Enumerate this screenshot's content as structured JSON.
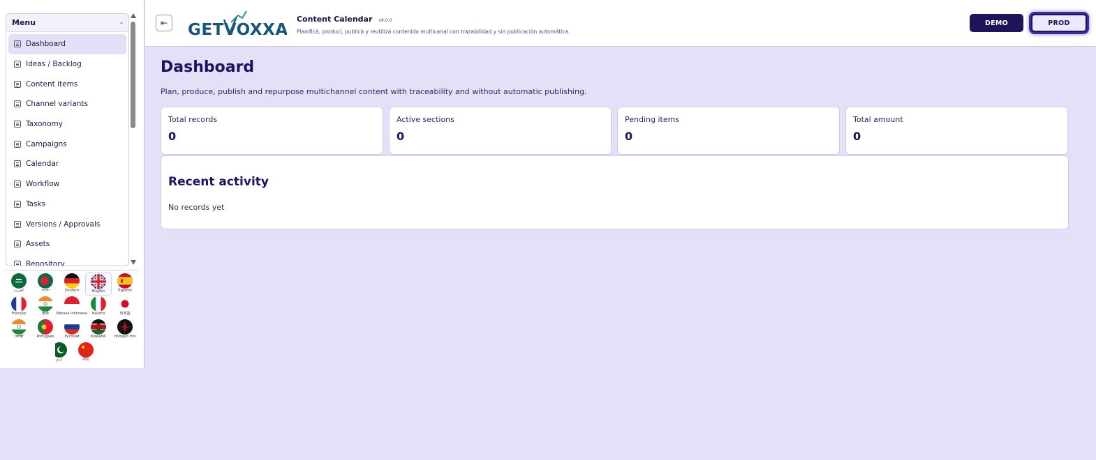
{
  "sidebar": {
    "menu_title": "Menu",
    "menu_toggle": "-",
    "items": [
      {
        "label": "Dashboard",
        "active": true
      },
      {
        "label": "Ideas / Backlog"
      },
      {
        "label": "Content items"
      },
      {
        "label": "Channel variants"
      },
      {
        "label": "Taxonomy"
      },
      {
        "label": "Campaigns"
      },
      {
        "label": "Calendar"
      },
      {
        "label": "Workflow"
      },
      {
        "label": "Tasks"
      },
      {
        "label": "Versions / Approvals"
      },
      {
        "label": "Assets"
      },
      {
        "label": "Repository"
      }
    ],
    "languages": [
      {
        "name": "العربية",
        "flag": "sa-flag-icon"
      },
      {
        "name": "বাংলা",
        "flag": "bd-flag-icon"
      },
      {
        "name": "Deutsch",
        "flag": "de-flag-icon"
      },
      {
        "name": "English",
        "flag": "gb-flag-icon",
        "selected": true
      },
      {
        "name": "Español",
        "flag": "es-flag-icon"
      },
      {
        "name": "Français",
        "flag": "fr-flag-icon"
      },
      {
        "name": "हिन्दी",
        "flag": "in-flag-icon"
      },
      {
        "name": "Bahasa Indonesia",
        "flag": "id-flag-icon"
      },
      {
        "name": "Italiano",
        "flag": "it-flag-icon"
      },
      {
        "name": "日本語",
        "flag": "jp-flag-icon"
      },
      {
        "name": "ਪੰਜਾਬੀ",
        "flag": "in-flag-icon"
      },
      {
        "name": "Português",
        "flag": "pt-flag-icon"
      },
      {
        "name": "Русский",
        "flag": "ru-flag-icon"
      },
      {
        "name": "Kiswahili",
        "flag": "ke-flag-icon"
      },
      {
        "name": "tlhIngan Hol",
        "flag": "klingon-flag-icon"
      },
      {
        "name": "اردو",
        "flag": "pk-flag-icon"
      },
      {
        "name": "中文",
        "flag": "cn-flag-icon"
      }
    ]
  },
  "topbar": {
    "collapse_icon": "collapse-sidebar-icon",
    "logo_text": "GETVOXXA",
    "app_title": "Content Calendar",
    "app_version": "v9.0.0",
    "app_subtitle": "Planificá, producí, publicá y reutilizá contenido multicanal con trazabilidad y sin publicación automática.",
    "env_demo": "DEMO",
    "env_prod": "PROD"
  },
  "main": {
    "title": "Dashboard",
    "description": "Plan, produce, publish and repurpose multichannel content with traceability and without automatic publishing.",
    "cards": [
      {
        "label": "Total records",
        "value": "0"
      },
      {
        "label": "Active sections",
        "value": "0"
      },
      {
        "label": "Pending items",
        "value": "0"
      },
      {
        "label": "Total amount",
        "value": "0"
      }
    ],
    "activity_title": "Recent activity",
    "activity_empty": "No records yet"
  },
  "colors": {
    "accent": "#1e145a",
    "background": "#e3e0f7",
    "logo": "#16577a"
  }
}
